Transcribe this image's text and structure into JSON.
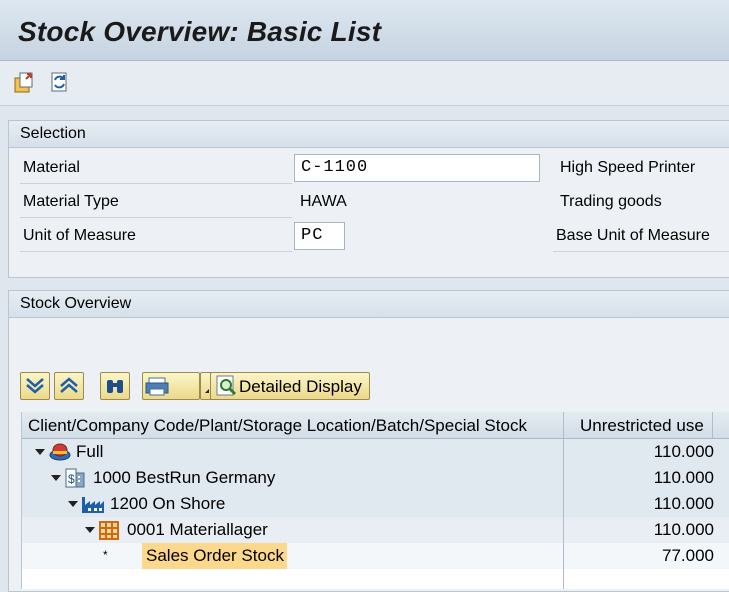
{
  "title": "Stock Overview: Basic List",
  "toolbar": {
    "icons": [
      "export-icon",
      "refresh-icon"
    ]
  },
  "selection": {
    "header": "Selection",
    "material_label": "Material",
    "material_value": "C-1100",
    "material_desc": "High Speed Printer",
    "material_type_label": "Material Type",
    "material_type_value": "HAWA",
    "material_type_desc": "Trading goods",
    "uom_label": "Unit of Measure",
    "uom_value": "PC",
    "uom_desc": "Base Unit of Measure"
  },
  "stock_overview": {
    "header": "Stock Overview",
    "detailed_display_label": "Detailed Display",
    "columns": [
      "Client/Company Code/Plant/Storage Location/Batch/Special Stock",
      "Unrestricted use"
    ],
    "rows": [
      {
        "label": "Full",
        "value": "110.000",
        "icon": "client-icon"
      },
      {
        "label": "1000 BestRun Germany",
        "value": "110.000",
        "icon": "company-code-icon"
      },
      {
        "label": "1200 On Shore",
        "value": "110.000",
        "icon": "plant-icon"
      },
      {
        "label": "0001 Materiallager",
        "value": "110.000",
        "icon": "storage-location-icon"
      },
      {
        "label": "Sales Order Stock",
        "value": "77.000",
        "marker": "*"
      }
    ]
  },
  "colors": {
    "row_highlight": "#e0e8f0",
    "selected_cell": "#fcd88c",
    "button_yellow": "#f4e7a6"
  }
}
